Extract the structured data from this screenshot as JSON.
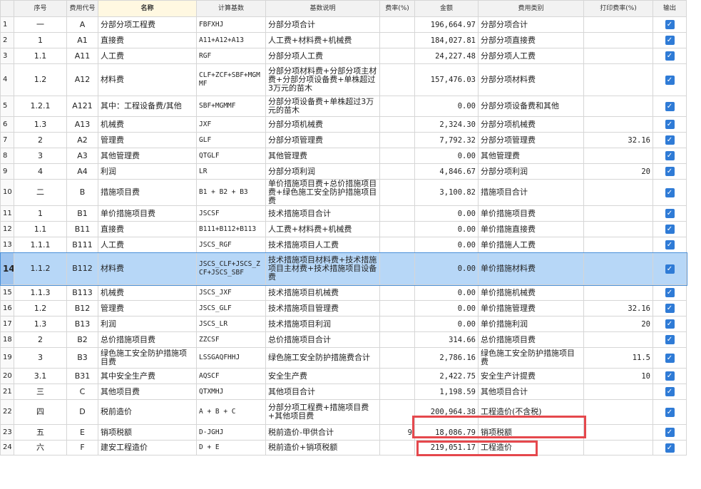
{
  "headers": [
    "",
    "序号",
    "费用代号",
    "名称",
    "计算基数",
    "基数说明",
    "费率(%)",
    "金额",
    "费用类别",
    "打印费率(%)",
    "输出"
  ],
  "rows": [
    {
      "idx": "1",
      "seq": "一",
      "code": "A",
      "name": "分部分项工程费",
      "base": "FBFXHJ",
      "desc": "分部分项合计",
      "rate": "",
      "amount": "196,664.97",
      "category": "分部分项合计",
      "print_rate": "",
      "output": "✓"
    },
    {
      "idx": "2",
      "seq": "1",
      "code": "A1",
      "name": "直接费",
      "base": "A11+A12+A13",
      "desc": "人工费+材料费+机械费",
      "rate": "",
      "amount": "184,027.81",
      "category": "分部分项直接费",
      "print_rate": "",
      "output": "✓"
    },
    {
      "idx": "3",
      "seq": "1.1",
      "code": "A11",
      "name": "人工费",
      "base": "RGF",
      "desc": "分部分项人工费",
      "rate": "",
      "amount": "24,227.48",
      "category": "分部分项人工费",
      "print_rate": "",
      "output": "✓"
    },
    {
      "idx": "4",
      "seq": "1.2",
      "code": "A12",
      "name": "材料费",
      "base": "CLF+ZCF+SBF+MGMMF",
      "desc": "分部分项材料费+分部分项主材费+分部分项设备费+单株超过3万元的苗木",
      "rate": "",
      "amount": "157,476.03",
      "category": "分部分项材料费",
      "print_rate": "",
      "output": "✓"
    },
    {
      "idx": "5",
      "seq": "1.2.1",
      "code": "A121",
      "name": "其中：工程设备费/其他",
      "base": "SBF+MGMMF",
      "desc": "分部分项设备费+单株超过3万元的苗木",
      "rate": "",
      "amount": "0.00",
      "category": "分部分项设备费和其他",
      "print_rate": "",
      "output": "✓"
    },
    {
      "idx": "6",
      "seq": "1.3",
      "code": "A13",
      "name": "机械费",
      "base": "JXF",
      "desc": "分部分项机械费",
      "rate": "",
      "amount": "2,324.30",
      "category": "分部分项机械费",
      "print_rate": "",
      "output": "✓"
    },
    {
      "idx": "7",
      "seq": "2",
      "code": "A2",
      "name": "管理费",
      "base": "GLF",
      "desc": "分部分项管理费",
      "rate": "",
      "amount": "7,792.32",
      "category": "分部分项管理费",
      "print_rate": "32.16",
      "output": "✓"
    },
    {
      "idx": "8",
      "seq": "3",
      "code": "A3",
      "name": "其他管理费",
      "base": "QTGLF",
      "desc": "其他管理费",
      "rate": "",
      "amount": "0.00",
      "category": "其他管理费",
      "print_rate": "",
      "output": "✓"
    },
    {
      "idx": "9",
      "seq": "4",
      "code": "A4",
      "name": "利润",
      "base": "LR",
      "desc": "分部分项利润",
      "rate": "",
      "amount": "4,846.67",
      "category": "分部分项利润",
      "print_rate": "20",
      "output": "✓"
    },
    {
      "idx": "10",
      "seq": "二",
      "code": "B",
      "name": "措施项目费",
      "base": "B1 + B2 + B3",
      "desc": "单价措施项目费+总价措施项目费+绿色施工安全防护措施项目费",
      "rate": "",
      "amount": "3,100.82",
      "category": "措施项目合计",
      "print_rate": "",
      "output": "✓"
    },
    {
      "idx": "11",
      "seq": "1",
      "code": "B1",
      "name": "单价措施项目费",
      "base": "JSCSF",
      "desc": "技术措施项目合计",
      "rate": "",
      "amount": "0.00",
      "category": "单价措施项目费",
      "print_rate": "",
      "output": "✓"
    },
    {
      "idx": "12",
      "seq": "1.1",
      "code": "B11",
      "name": "直接费",
      "base": "B111+B112+B113",
      "desc": "人工费+材料费+机械费",
      "rate": "",
      "amount": "0.00",
      "category": "单价措施直接费",
      "print_rate": "",
      "output": "✓"
    },
    {
      "idx": "13",
      "seq": "1.1.1",
      "code": "B111",
      "name": "人工费",
      "base": "JSCS_RGF",
      "desc": "技术措施项目人工费",
      "rate": "",
      "amount": "0.00",
      "category": "单价措施人工费",
      "print_rate": "",
      "output": "✓"
    },
    {
      "idx": "14",
      "seq": "1.1.2",
      "code": "B112",
      "name": "材料费",
      "base": "JSCS_CLF+JSCS_ZCF+JSCS_SBF",
      "desc": "技术措施项目材料费+技术措施项目主材费+技术措施项目设备费",
      "rate": "",
      "amount": "0.00",
      "category": "单价措施材料费",
      "print_rate": "",
      "output": "✓"
    },
    {
      "idx": "15",
      "seq": "1.1.3",
      "code": "B113",
      "name": "机械费",
      "base": "JSCS_JXF",
      "desc": "技术措施项目机械费",
      "rate": "",
      "amount": "0.00",
      "category": "单价措施机械费",
      "print_rate": "",
      "output": "✓"
    },
    {
      "idx": "16",
      "seq": "1.2",
      "code": "B12",
      "name": "管理费",
      "base": "JSCS_GLF",
      "desc": "技术措施项目管理费",
      "rate": "",
      "amount": "0.00",
      "category": "单价措施管理费",
      "print_rate": "32.16",
      "output": "✓"
    },
    {
      "idx": "17",
      "seq": "1.3",
      "code": "B13",
      "name": "利润",
      "base": "JSCS_LR",
      "desc": "技术措施项目利润",
      "rate": "",
      "amount": "0.00",
      "category": "单价措施利润",
      "print_rate": "20",
      "output": "✓"
    },
    {
      "idx": "18",
      "seq": "2",
      "code": "B2",
      "name": "总价措施项目费",
      "base": "ZZCSF",
      "desc": "总价措施项目合计",
      "rate": "",
      "amount": "314.66",
      "category": "总价措施项目费",
      "print_rate": "",
      "output": "✓"
    },
    {
      "idx": "19",
      "seq": "3",
      "code": "B3",
      "name": "绿色施工安全防护措施项目费",
      "base": "LSSGAQFHHJ",
      "desc": "绿色施工安全防护措施费合计",
      "rate": "",
      "amount": "2,786.16",
      "category": "绿色施工安全防护措施项目费",
      "print_rate": "11.5",
      "output": "✓"
    },
    {
      "idx": "20",
      "seq": "3.1",
      "code": "B31",
      "name": "其中安全生产费",
      "base": "AQSCF",
      "desc": "安全生产费",
      "rate": "",
      "amount": "2,422.75",
      "category": "安全生产计提费",
      "print_rate": "10",
      "output": "✓"
    },
    {
      "idx": "21",
      "seq": "三",
      "code": "C",
      "name": "其他项目费",
      "base": "QTXMHJ",
      "desc": "其他项目合计",
      "rate": "",
      "amount": "1,198.59",
      "category": "其他项目合计",
      "print_rate": "",
      "output": "✓"
    },
    {
      "idx": "22",
      "seq": "四",
      "code": "D",
      "name": "税前造价",
      "base": "A + B + C",
      "desc": "分部分项工程费+措施项目费+其他项目费",
      "rate": "",
      "amount": "200,964.38",
      "category": "工程造价(不含税)",
      "print_rate": "",
      "output": "✓"
    },
    {
      "idx": "23",
      "seq": "五",
      "code": "E",
      "name": "销项税额",
      "base": "D-JGHJ",
      "desc": "税前造价-甲供合计",
      "rate": "9",
      "amount": "18,086.79",
      "category": "销项税额",
      "print_rate": "",
      "output": "✓"
    },
    {
      "idx": "24",
      "seq": "六",
      "code": "F",
      "name": "建安工程造价",
      "base": "D + E",
      "desc": "税前造价+销项税额",
      "rate": "",
      "amount": "219,051.17",
      "category": "工程造价",
      "print_rate": "",
      "output": "✓"
    }
  ],
  "selected_row": "14",
  "colors": {
    "selection": "#b7d7f7",
    "checkbox": "#2f7bd6",
    "highlight": "#e5484d"
  }
}
